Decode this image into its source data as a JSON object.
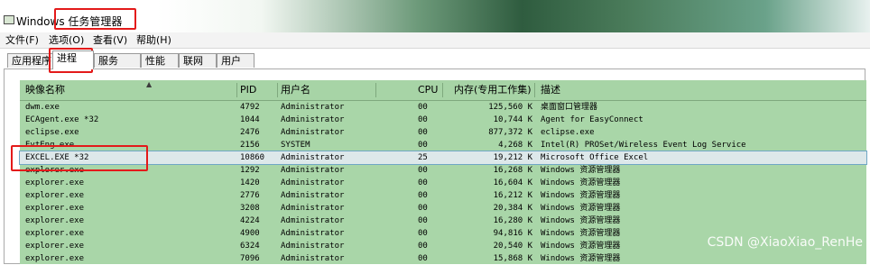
{
  "window": {
    "title": "Windows 任务管理器"
  },
  "menu": [
    "文件(F)",
    "选项(O)",
    "查看(V)",
    "帮助(H)"
  ],
  "tabs": [
    {
      "label": "应用程序",
      "active": false
    },
    {
      "label": "进程",
      "active": true
    },
    {
      "label": "服务",
      "active": false
    },
    {
      "label": "性能",
      "active": false
    },
    {
      "label": "联网",
      "active": false
    },
    {
      "label": "用户",
      "active": false
    }
  ],
  "table": {
    "columns": [
      "映像名称",
      "PID",
      "用户名",
      "CPU",
      "内存(专用工作集)",
      "描述"
    ],
    "rows": [
      {
        "name": "dwm.exe",
        "pid": "4792",
        "user": "Administrator",
        "cpu": "00",
        "mem": "125,560 K",
        "desc": "桌面窗口管理器",
        "selected": false
      },
      {
        "name": "ECAgent.exe *32",
        "pid": "1044",
        "user": "Administrator",
        "cpu": "00",
        "mem": "10,744 K",
        "desc": "Agent for EasyConnect",
        "selected": false
      },
      {
        "name": "eclipse.exe",
        "pid": "2476",
        "user": "Administrator",
        "cpu": "00",
        "mem": "877,372 K",
        "desc": "eclipse.exe",
        "selected": false
      },
      {
        "name": "EvtEng.exe",
        "pid": "2156",
        "user": "SYSTEM",
        "cpu": "00",
        "mem": "4,268 K",
        "desc": "Intel(R) PROSet/Wireless Event Log Service",
        "selected": false
      },
      {
        "name": "EXCEL.EXE *32",
        "pid": "10860",
        "user": "Administrator",
        "cpu": "25",
        "mem": "19,212 K",
        "desc": "Microsoft Office Excel",
        "selected": true
      },
      {
        "name": "explorer.exe",
        "pid": "1292",
        "user": "Administrator",
        "cpu": "00",
        "mem": "16,268 K",
        "desc": "Windows 资源管理器",
        "selected": false
      },
      {
        "name": "explorer.exe",
        "pid": "1420",
        "user": "Administrator",
        "cpu": "00",
        "mem": "16,604 K",
        "desc": "Windows 资源管理器",
        "selected": false
      },
      {
        "name": "explorer.exe",
        "pid": "2776",
        "user": "Administrator",
        "cpu": "00",
        "mem": "16,212 K",
        "desc": "Windows 资源管理器",
        "selected": false
      },
      {
        "name": "explorer.exe",
        "pid": "3208",
        "user": "Administrator",
        "cpu": "00",
        "mem": "20,384 K",
        "desc": "Windows 资源管理器",
        "selected": false
      },
      {
        "name": "explorer.exe",
        "pid": "4224",
        "user": "Administrator",
        "cpu": "00",
        "mem": "16,280 K",
        "desc": "Windows 资源管理器",
        "selected": false
      },
      {
        "name": "explorer.exe",
        "pid": "4900",
        "user": "Administrator",
        "cpu": "00",
        "mem": "94,816 K",
        "desc": "Windows 资源管理器",
        "selected": false
      },
      {
        "name": "explorer.exe",
        "pid": "6324",
        "user": "Administrator",
        "cpu": "00",
        "mem": "20,540 K",
        "desc": "Windows 资源管理器",
        "selected": false
      },
      {
        "name": "explorer.exe",
        "pid": "7096",
        "user": "Administrator",
        "cpu": "00",
        "mem": "15,868 K",
        "desc": "Windows 资源管理器",
        "selected": false
      }
    ]
  },
  "watermark": "CSDN @XiaoXiao_RenHe",
  "colors": {
    "table_bg": "#a9d6a8",
    "selected_row": "#dde8ea",
    "highlight_box": "#e31a1a"
  }
}
